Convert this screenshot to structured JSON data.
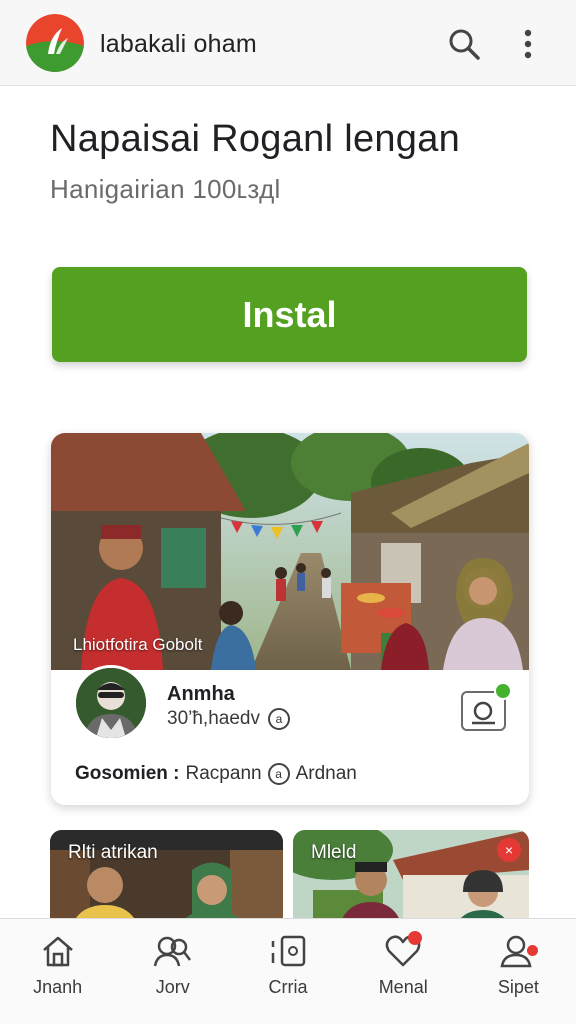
{
  "header": {
    "app_name": "labakali oham",
    "search_icon": "search-icon",
    "menu_icon": "more-vert-icon"
  },
  "hero": {
    "title": "Napaisai Roganl lengan",
    "subtitle": "Hanigairian 100ʟздl"
  },
  "install_button": {
    "label": "Instal",
    "color": "#54a021"
  },
  "featured_card": {
    "photo_caption": "Lhiotfotira Gobolt",
    "host_name": "Anmha",
    "host_meta": "30’ħ,haedv",
    "meta_badge": "a",
    "footer_label": "Gosomien :",
    "footer_value_1": "Racpann",
    "footer_badge": "a",
    "footer_value_2": "Ardnan",
    "follow_status_color": "#44b22f"
  },
  "mini_cards": [
    {
      "label": "Rlti atrikan"
    },
    {
      "label": "Mleld",
      "badge": "×"
    }
  ],
  "bottom_nav": [
    {
      "label": "Jnanh",
      "icon": "home-icon"
    },
    {
      "label": "Jorv",
      "icon": "people-search-icon"
    },
    {
      "label": "Crria",
      "icon": "tablet-icon"
    },
    {
      "label": "Menal",
      "icon": "heart-icon",
      "badge": true
    },
    {
      "label": "Sipet",
      "icon": "profile-icon",
      "badge": true
    }
  ]
}
